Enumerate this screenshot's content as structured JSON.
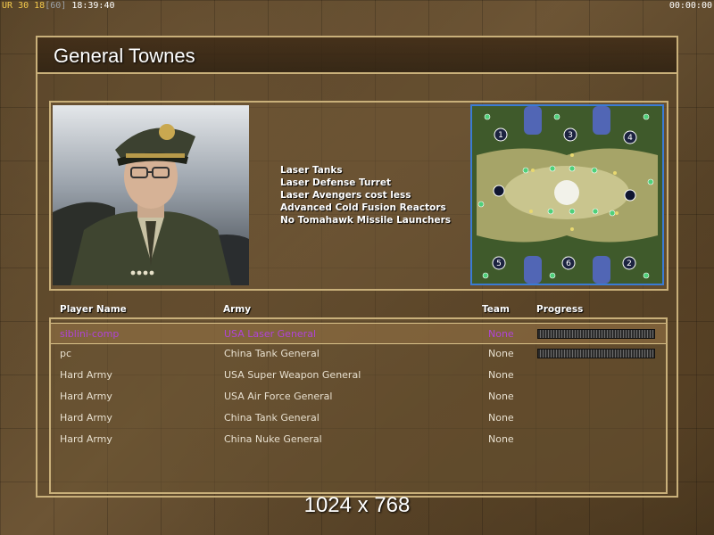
{
  "topbar": {
    "fps_prefix": "UR",
    "fps_a": "30",
    "fps_b": "18",
    "fps_c": "[60]",
    "clock": "18:39:40",
    "timer": "00:00:00"
  },
  "general": {
    "title": "General Townes",
    "features": [
      "Laser Tanks",
      "Laser Defense Turret",
      "Laser Avengers cost less",
      "Advanced Cold Fusion Reactors",
      "No Tomahawk Missile Launchers"
    ]
  },
  "minimap": {
    "start_positions": [
      "1",
      "3",
      "4",
      "5",
      "6",
      "2"
    ]
  },
  "table": {
    "headers": {
      "player": "Player Name",
      "army": "Army",
      "team": "Team",
      "progress": "Progress"
    },
    "rows": [
      {
        "player": "siblini-comp",
        "army": "USA Laser General",
        "team": "None",
        "progress": 1.0
      },
      {
        "player": "pc",
        "army": "China Tank General",
        "team": "None",
        "progress": 1.0
      },
      {
        "player": "Hard Army",
        "army": "USA Super Weapon General",
        "team": "None"
      },
      {
        "player": "Hard Army",
        "army": "USA Air Force General",
        "team": "None"
      },
      {
        "player": "Hard Army",
        "army": "China Tank General",
        "team": "None"
      },
      {
        "player": "Hard Army",
        "army": "China Nuke General",
        "team": "None"
      }
    ]
  },
  "resolution": "1024 x 768",
  "colors": {
    "frame": "#c9b07a",
    "highlight_player": "#b044d6",
    "minimap_border": "#3a7bd5"
  }
}
